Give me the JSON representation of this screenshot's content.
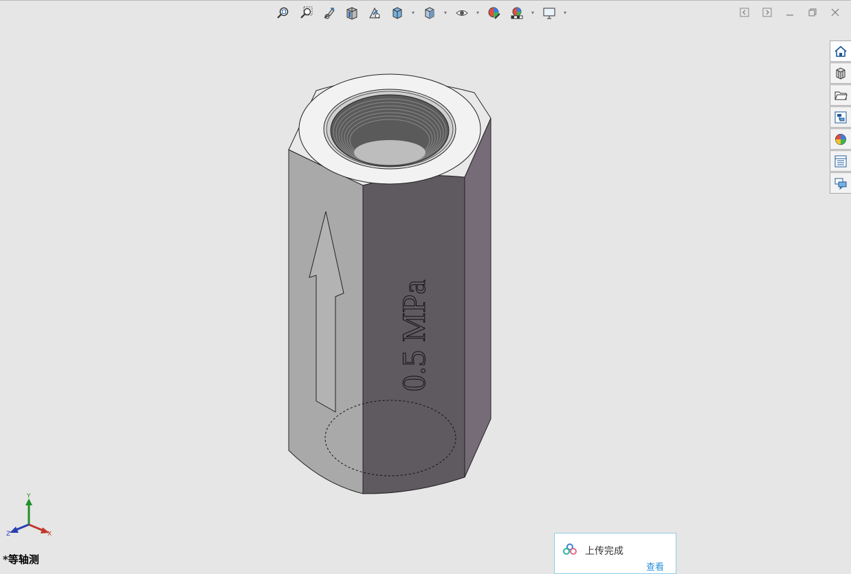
{
  "toolbar": {
    "items": [
      {
        "name": "zoom-to-fit-icon"
      },
      {
        "name": "zoom-to-area-icon"
      },
      {
        "name": "previous-view-icon"
      },
      {
        "name": "section-view-icon"
      },
      {
        "name": "dynamic-annotation-icon"
      },
      {
        "name": "view-orientation-icon",
        "dropdown": true
      },
      {
        "name": "display-style-icon",
        "dropdown": true
      },
      {
        "name": "hide-show-items-icon",
        "dropdown": true
      },
      {
        "name": "edit-appearance-icon"
      },
      {
        "name": "apply-scene-icon",
        "dropdown": true
      },
      {
        "name": "view-settings-icon",
        "dropdown": true
      }
    ]
  },
  "window_controls": [
    "tile-left-icon",
    "tile-right-icon",
    "minimize-icon",
    "restore-icon",
    "close-icon"
  ],
  "task_pane": [
    "home-icon",
    "3d-content-icon",
    "design-library-icon",
    "file-explorer-icon",
    "appearances-icon",
    "custom-properties-icon",
    "forum-icon"
  ],
  "model": {
    "engraving_text": "0.5 MPa",
    "colors": {
      "face_left": "#a9a9a9",
      "face_front": "#5e5a5f",
      "face_right": "#766c78",
      "top": "#e9e9e9",
      "bore": "#5a5a5a"
    }
  },
  "triad": {
    "x_label": "X",
    "y_label": "Y",
    "z_label": "Z"
  },
  "view_label": "*等轴测",
  "notification": {
    "title": "上传完成",
    "link": "查看"
  }
}
